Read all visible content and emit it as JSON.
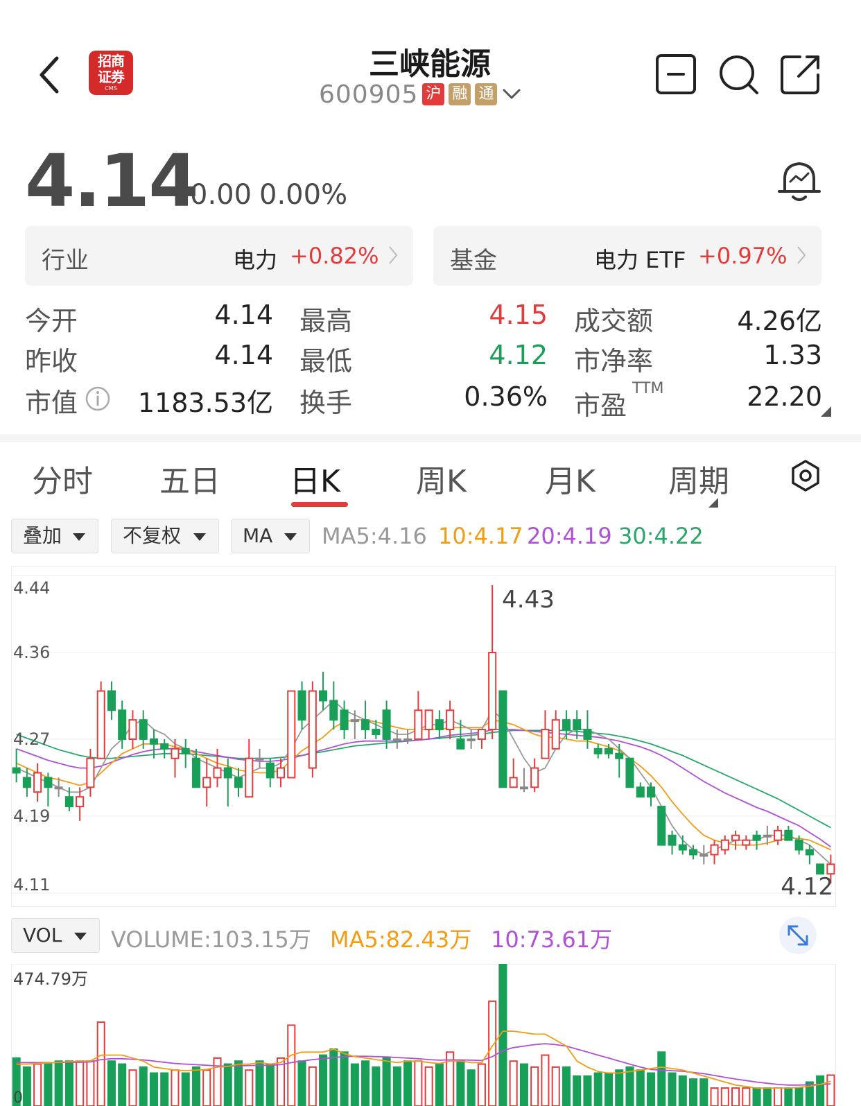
{
  "header": {
    "broker_logo": {
      "line1": "招商",
      "line2": "证券",
      "line3": "CMS"
    },
    "title": "三峡能源",
    "code": "600905",
    "tags": [
      "沪",
      "融",
      "通"
    ]
  },
  "quote": {
    "price": "4.14",
    "change": "0.00",
    "change_pct": "0.00%"
  },
  "industry_card": {
    "label": "行业",
    "name": "电力",
    "pct": "+0.82%"
  },
  "fund_card": {
    "label": "基金",
    "name": "电力 ETF",
    "pct": "+0.97%"
  },
  "stats": {
    "open_label": "今开",
    "open": "4.14",
    "high_label": "最高",
    "high": "4.15",
    "amount_label": "成交额",
    "amount": "4.26亿",
    "prev_label": "昨收",
    "prev": "4.14",
    "low_label": "最低",
    "low": "4.12",
    "pb_label": "市净率",
    "pb": "1.33",
    "mcap_label": "市值",
    "mcap": "1183.53亿",
    "turnover_label": "换手",
    "turnover": "0.36%",
    "pe_label": "市盈",
    "pe_sup": "TTM",
    "pe": "22.20"
  },
  "period_tabs": [
    "分时",
    "五日",
    "日K",
    "周K",
    "月K",
    "周期"
  ],
  "active_tab": 2,
  "controls": {
    "overlay": "叠加",
    "adjust": "不复权",
    "indicator": "MA",
    "ma5": "MA5:4.16",
    "ma10": "10:4.17",
    "ma20": "20:4.19",
    "ma30": "30:4.22"
  },
  "colors": {
    "up": "#e33b3b",
    "down": "#18a058",
    "ma5": "#999999",
    "ma10": "#f39c12",
    "ma20": "#b04fd8",
    "ma30": "#27a86a"
  },
  "chart_data": [
    {
      "type": "candlestick",
      "y_ticks": [
        "4.44",
        "4.36",
        "4.27",
        "4.19",
        "4.11"
      ],
      "ylim": [
        4.11,
        4.44
      ],
      "max_label": "4.43",
      "last_label": "4.12",
      "candles": [
        [
          4.24,
          4.235,
          4.26,
          4.225
        ],
        [
          4.23,
          4.22,
          4.24,
          4.21
        ],
        [
          4.215,
          4.235,
          4.245,
          4.205
        ],
        [
          4.23,
          4.22,
          4.235,
          4.2
        ],
        [
          4.22,
          4.22,
          4.23,
          4.21
        ],
        [
          4.21,
          4.2,
          4.22,
          4.195
        ],
        [
          4.2,
          4.21,
          4.22,
          4.185
        ],
        [
          4.22,
          4.25,
          4.26,
          4.21
        ],
        [
          4.25,
          4.32,
          4.33,
          4.25
        ],
        [
          4.32,
          4.3,
          4.33,
          4.29
        ],
        [
          4.3,
          4.27,
          4.31,
          4.26
        ],
        [
          4.27,
          4.29,
          4.3,
          4.26
        ],
        [
          4.29,
          4.27,
          4.3,
          4.26
        ],
        [
          4.27,
          4.265,
          4.28,
          4.25
        ],
        [
          4.265,
          4.26,
          4.27,
          4.25
        ],
        [
          4.25,
          4.26,
          4.27,
          4.23
        ],
        [
          4.26,
          4.255,
          4.27,
          4.24
        ],
        [
          4.25,
          4.22,
          4.26,
          4.22
        ],
        [
          4.22,
          4.23,
          4.25,
          4.2
        ],
        [
          4.23,
          4.24,
          4.26,
          4.22
        ],
        [
          4.24,
          4.23,
          4.25,
          4.2
        ],
        [
          4.23,
          4.22,
          4.24,
          4.21
        ],
        [
          4.21,
          4.25,
          4.27,
          4.21
        ],
        [
          4.25,
          4.25,
          4.26,
          4.24
        ],
        [
          4.245,
          4.23,
          4.25,
          4.22
        ],
        [
          4.23,
          4.24,
          4.25,
          4.22
        ],
        [
          4.23,
          4.32,
          4.32,
          4.23
        ],
        [
          4.32,
          4.29,
          4.33,
          4.28
        ],
        [
          4.24,
          4.32,
          4.33,
          4.23
        ],
        [
          4.32,
          4.31,
          4.34,
          4.3
        ],
        [
          4.31,
          4.29,
          4.33,
          4.28
        ],
        [
          4.3,
          4.28,
          4.31,
          4.27
        ],
        [
          4.29,
          4.29,
          4.3,
          4.27
        ],
        [
          4.29,
          4.28,
          4.31,
          4.27
        ],
        [
          4.28,
          4.275,
          4.29,
          4.27
        ],
        [
          4.3,
          4.27,
          4.31,
          4.26
        ],
        [
          4.27,
          4.27,
          4.28,
          4.26
        ],
        [
          4.27,
          4.27,
          4.28,
          4.265
        ],
        [
          4.27,
          4.3,
          4.32,
          4.27
        ],
        [
          4.28,
          4.3,
          4.3,
          4.27
        ],
        [
          4.29,
          4.28,
          4.3,
          4.27
        ],
        [
          4.28,
          4.3,
          4.31,
          4.27
        ],
        [
          4.27,
          4.26,
          4.29,
          4.26
        ],
        [
          4.27,
          4.27,
          4.28,
          4.26
        ],
        [
          4.27,
          4.28,
          4.28,
          4.26
        ],
        [
          4.28,
          4.36,
          4.43,
          4.27
        ],
        [
          4.32,
          4.22,
          4.32,
          4.22
        ],
        [
          4.22,
          4.23,
          4.25,
          4.22
        ],
        [
          4.22,
          4.22,
          4.24,
          4.215
        ],
        [
          4.22,
          4.24,
          4.25,
          4.215
        ],
        [
          4.25,
          4.28,
          4.3,
          4.25
        ],
        [
          4.26,
          4.29,
          4.3,
          4.26
        ],
        [
          4.29,
          4.28,
          4.3,
          4.27
        ],
        [
          4.29,
          4.28,
          4.3,
          4.27
        ],
        [
          4.28,
          4.27,
          4.3,
          4.26
        ],
        [
          4.26,
          4.255,
          4.265,
          4.25
        ],
        [
          4.26,
          4.255,
          4.265,
          4.25
        ],
        [
          4.255,
          4.25,
          4.265,
          4.23
        ],
        [
          4.25,
          4.22,
          4.25,
          4.22
        ],
        [
          4.22,
          4.21,
          4.225,
          4.21
        ],
        [
          4.22,
          4.21,
          4.225,
          4.2
        ],
        [
          4.2,
          4.16,
          4.2,
          4.16
        ],
        [
          4.17,
          4.16,
          4.175,
          4.15
        ],
        [
          4.16,
          4.155,
          4.17,
          4.15
        ],
        [
          4.155,
          4.15,
          4.16,
          4.145
        ],
        [
          4.15,
          4.15,
          4.16,
          4.14
        ],
        [
          4.15,
          4.16,
          4.165,
          4.14
        ],
        [
          4.155,
          4.165,
          4.17,
          4.15
        ],
        [
          4.165,
          4.17,
          4.175,
          4.155
        ],
        [
          4.16,
          4.165,
          4.17,
          4.155
        ],
        [
          4.17,
          4.165,
          4.175,
          4.155
        ],
        [
          4.17,
          4.17,
          4.18,
          4.16
        ],
        [
          4.165,
          4.175,
          4.18,
          4.16
        ],
        [
          4.175,
          4.165,
          4.18,
          4.165
        ],
        [
          4.165,
          4.155,
          4.17,
          4.15
        ],
        [
          4.155,
          4.15,
          4.16,
          4.14
        ],
        [
          4.14,
          4.13,
          4.14,
          4.13
        ],
        [
          4.13,
          4.14,
          4.15,
          4.12
        ]
      ],
      "ma5": [
        4.24,
        4.235,
        4.23,
        4.225,
        4.22,
        4.215,
        4.215,
        4.22,
        4.24,
        4.26,
        4.27,
        4.285,
        4.29,
        4.28,
        4.275,
        4.265,
        4.26,
        4.25,
        4.245,
        4.24,
        4.235,
        4.23,
        4.235,
        4.24,
        4.24,
        4.245,
        4.26,
        4.28,
        4.29,
        4.3,
        4.31,
        4.3,
        4.295,
        4.29,
        4.285,
        4.28,
        4.275,
        4.275,
        4.28,
        4.285,
        4.285,
        4.29,
        4.285,
        4.28,
        4.28,
        4.3,
        4.29,
        4.27,
        4.25,
        4.235,
        4.24,
        4.26,
        4.275,
        4.28,
        4.28,
        4.275,
        4.27,
        4.26,
        4.25,
        4.235,
        4.22,
        4.2,
        4.18,
        4.165,
        4.155,
        4.15,
        4.155,
        4.16,
        4.165,
        4.165,
        4.165,
        4.17,
        4.17,
        4.17,
        4.165,
        4.16,
        4.15,
        4.14
      ],
      "ma10": [
        4.245,
        4.24,
        4.235,
        4.23,
        4.228,
        4.225,
        4.222,
        4.225,
        4.235,
        4.245,
        4.255,
        4.26,
        4.265,
        4.265,
        4.265,
        4.262,
        4.26,
        4.255,
        4.25,
        4.245,
        4.242,
        4.238,
        4.236,
        4.235,
        4.235,
        4.238,
        4.248,
        4.258,
        4.265,
        4.272,
        4.282,
        4.288,
        4.29,
        4.29,
        4.288,
        4.285,
        4.282,
        4.28,
        4.28,
        4.28,
        4.28,
        4.282,
        4.282,
        4.282,
        4.282,
        4.29,
        4.288,
        4.285,
        4.28,
        4.275,
        4.272,
        4.272,
        4.27,
        4.268,
        4.268,
        4.265,
        4.262,
        4.258,
        4.25,
        4.242,
        4.232,
        4.22,
        4.205,
        4.192,
        4.18,
        4.17,
        4.165,
        4.162,
        4.16,
        4.16,
        4.16,
        4.162,
        4.165,
        4.167,
        4.167,
        4.165,
        4.16,
        4.155
      ],
      "ma20": [
        4.26,
        4.256,
        4.252,
        4.248,
        4.245,
        4.242,
        4.24,
        4.24,
        4.242,
        4.246,
        4.25,
        4.254,
        4.257,
        4.259,
        4.26,
        4.26,
        4.259,
        4.257,
        4.255,
        4.253,
        4.251,
        4.249,
        4.248,
        4.247,
        4.247,
        4.248,
        4.25,
        4.253,
        4.256,
        4.259,
        4.262,
        4.265,
        4.267,
        4.268,
        4.268,
        4.268,
        4.268,
        4.268,
        4.269,
        4.27,
        4.272,
        4.274,
        4.275,
        4.276,
        4.277,
        4.28,
        4.28,
        4.28,
        4.279,
        4.278,
        4.277,
        4.276,
        4.275,
        4.274,
        4.273,
        4.272,
        4.27,
        4.268,
        4.265,
        4.262,
        4.258,
        4.253,
        4.247,
        4.24,
        4.233,
        4.226,
        4.22,
        4.214,
        4.209,
        4.204,
        4.199,
        4.195,
        4.19,
        4.185,
        4.18,
        4.173,
        4.166,
        4.158
      ],
      "ma30": [
        4.275,
        4.271,
        4.267,
        4.263,
        4.259,
        4.256,
        4.253,
        4.251,
        4.25,
        4.25,
        4.251,
        4.252,
        4.253,
        4.254,
        4.255,
        4.255,
        4.255,
        4.254,
        4.253,
        4.252,
        4.251,
        4.25,
        4.25,
        4.25,
        4.25,
        4.251,
        4.252,
        4.253,
        4.255,
        4.257,
        4.259,
        4.261,
        4.263,
        4.264,
        4.265,
        4.266,
        4.267,
        4.268,
        4.269,
        4.27,
        4.271,
        4.272,
        4.273,
        4.274,
        4.275,
        4.277,
        4.278,
        4.279,
        4.279,
        4.279,
        4.279,
        4.279,
        4.279,
        4.278,
        4.277,
        4.276,
        4.275,
        4.273,
        4.271,
        4.268,
        4.265,
        4.261,
        4.257,
        4.253,
        4.248,
        4.243,
        4.238,
        4.233,
        4.228,
        4.223,
        4.218,
        4.213,
        4.208,
        4.202,
        4.196,
        4.19,
        4.184,
        4.178
      ]
    },
    {
      "type": "bar",
      "title": "VOL",
      "volume_label": "VOLUME:103.15万",
      "ma5_label": "MA5:82.43万",
      "ma10_label": "10:73.61万",
      "y_max_label": "474.79万",
      "y_min_label": "0",
      "ylim": [
        0,
        474.79
      ],
      "volumes": [
        160,
        130,
        140,
        140,
        150,
        150,
        150,
        150,
        280,
        150,
        140,
        120,
        130,
        110,
        110,
        120,
        110,
        130,
        120,
        160,
        140,
        150,
        120,
        150,
        140,
        160,
        270,
        150,
        130,
        170,
        190,
        180,
        140,
        150,
        130,
        160,
        130,
        150,
        150,
        130,
        140,
        180,
        150,
        120,
        140,
        350,
        474.79,
        150,
        140,
        130,
        170,
        130,
        130,
        100,
        100,
        110,
        110,
        120,
        130,
        120,
        110,
        180,
        110,
        100,
        90,
        90,
        60,
        60,
        60,
        60,
        60,
        60,
        60,
        60,
        60,
        80,
        100,
        103.15
      ],
      "vol_ma5": [
        140,
        140,
        142,
        144,
        146,
        148,
        150,
        150,
        170,
        170,
        170,
        160,
        150,
        130,
        125,
        120,
        118,
        120,
        122,
        130,
        132,
        140,
        140,
        145,
        140,
        145,
        170,
        180,
        180,
        180,
        190,
        175,
        165,
        160,
        155,
        150,
        145,
        150,
        150,
        145,
        142,
        150,
        150,
        145,
        145,
        200,
        250,
        250,
        245,
        240,
        240,
        220,
        200,
        150,
        130,
        115,
        110,
        110,
        115,
        120,
        125,
        130,
        125,
        120,
        110,
        100,
        90,
        80,
        70,
        65,
        60,
        60,
        60,
        60,
        62,
        66,
        72,
        82.43
      ],
      "vol_ma10": [
        145,
        145,
        145,
        145,
        145,
        146,
        146,
        147,
        155,
        158,
        158,
        156,
        154,
        150,
        146,
        142,
        140,
        138,
        136,
        134,
        133,
        134,
        135,
        136,
        136,
        138,
        145,
        150,
        155,
        158,
        162,
        165,
        166,
        166,
        165,
        164,
        162,
        160,
        158,
        155,
        153,
        154,
        154,
        153,
        152,
        165,
        185,
        195,
        200,
        205,
        208,
        205,
        200,
        190,
        180,
        170,
        160,
        150,
        140,
        130,
        122,
        120,
        118,
        116,
        112,
        108,
        102,
        96,
        90,
        85,
        80,
        76,
        72,
        70,
        70,
        71,
        72,
        73.61
      ]
    }
  ],
  "vol_controls": {
    "indicator": "VOL"
  }
}
